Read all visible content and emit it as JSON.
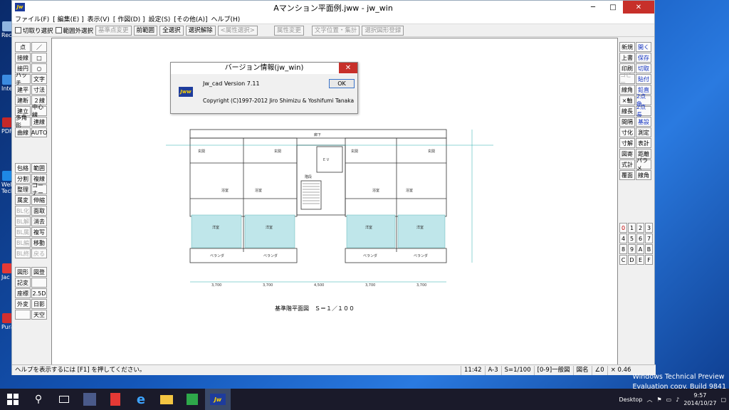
{
  "window": {
    "title": "Aマンション平面例.jww - jw_win",
    "logo": "Jw"
  },
  "menu": [
    "ファイル(F)",
    "[ 編集(E) ]",
    "表示(V)",
    "[ 作図(D) ]",
    "設定(S)",
    "[その他(A)]",
    "ヘルプ(H)"
  ],
  "toolbar": {
    "chk1": "切取り選択",
    "chk2": "範囲外選択",
    "btn1": "基準点変更",
    "btn2": "前範囲",
    "btn3": "全選択",
    "btn4": "選択解除",
    "btn5": "<属性選択>",
    "btn6": "属性変更",
    "btn7": "文字位置・集計",
    "btn8": "選択図形登録"
  },
  "left_tools_a": [
    "点",
    "／",
    "接線",
    "□",
    "接円",
    "○",
    "ハッチ",
    "文字",
    "建平",
    "寸法",
    "建断",
    "２線",
    "建立",
    "中心線",
    "多角形",
    "連線",
    "曲線",
    "AUTO"
  ],
  "left_tools_b": [
    "包絡",
    "範囲",
    "分割",
    "複線",
    "整理",
    "コーナー",
    "属変",
    "伸縮",
    "BL化",
    "面取",
    "BL解",
    "消去",
    "BL属",
    "複写",
    "BL編",
    "移動",
    "BL終",
    "戻る"
  ],
  "left_tools_c": [
    "図形",
    "図登",
    "記変",
    "",
    "座標",
    "2.5D",
    "外変",
    "日影",
    "",
    "天空"
  ],
  "right_tools_a": [
    "新規",
    "開く",
    "上書",
    "保存",
    "印刷",
    "切取",
    "コピー",
    "貼付",
    "線角",
    "鉛直",
    "×軸",
    "2点角",
    "線長",
    "2点長",
    "間隔",
    "基設",
    "寸化",
    "測定",
    "寸解",
    "表計",
    "図寄",
    "距離",
    "式計",
    "パラメ",
    "覆面",
    "線角"
  ],
  "layer_nums": [
    "0",
    "1",
    "2",
    "3",
    "4",
    "5",
    "6",
    "7",
    "8",
    "9",
    "A",
    "B",
    "C",
    "D",
    "E",
    "F"
  ],
  "dialog": {
    "title": "バージョン情報(jw_win)",
    "version": "Jw_cad Version 7.11",
    "copyright": "Copyright (C)1997-2012 Jiro Shimizu & Yoshifumi Tanaka",
    "ok": "OK",
    "logo": "Jww"
  },
  "drawing": {
    "caption": "基準階平面図　Ｓ＝１／１００",
    "corridor": "廊下",
    "ev_hall": "ＥＶ\nホール",
    "ev": "ＥＶ",
    "stairs": "階段",
    "entrance": "玄関",
    "wash": "洗面\n脱衣室",
    "bath": "浴室",
    "western": "洋室",
    "balcony": "ベランダ",
    "dims": [
      "3,700",
      "3,700",
      "4,500",
      "3,700",
      "3,700"
    ]
  },
  "status": {
    "help": "ヘルプを表示するには [F1] を押してください。",
    "time": "11:42",
    "paper": "A-3",
    "scale": "S=1/100",
    "layer": "[0-9]一般図",
    "group": "図名",
    "angle": "∠0",
    "zoom": "× 0.46"
  },
  "taskbar": {
    "desktop_label": "Desktop",
    "time": "9:57",
    "date": "2014/10/27"
  },
  "watermark": {
    "line1": "Windows Technical Preview",
    "line2": "Evaluation copy. Build 9841"
  },
  "desktop_icons": [
    "Rec",
    "Inte",
    "PDF",
    "Wel Tech",
    "Jac",
    "Pura"
  ]
}
